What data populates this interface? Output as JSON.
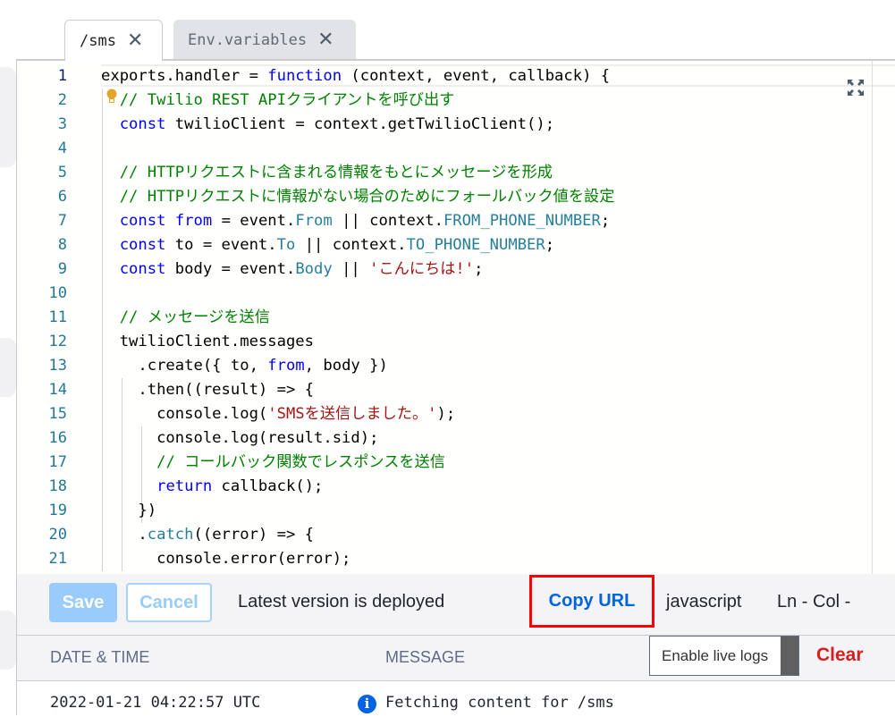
{
  "tabs": [
    {
      "label": "/sms",
      "active": true
    },
    {
      "label": "Env.variables",
      "active": false
    }
  ],
  "editor": {
    "active_line": 1,
    "lines": [
      [
        [
          "exports.handler = ",
          ""
        ],
        [
          "function",
          "kw"
        ],
        [
          " (context, event, callback) {",
          ""
        ]
      ],
      [
        [
          "  ",
          ""
        ],
        [
          "// Twilio REST APIクライアントを呼び出す",
          "cm"
        ]
      ],
      [
        [
          "  ",
          ""
        ],
        [
          "const",
          "kw"
        ],
        [
          " twilioClient = context.getTwilioClient();",
          ""
        ]
      ],
      [],
      [
        [
          "  ",
          ""
        ],
        [
          "// HTTPリクエストに含まれる情報をもとにメッセージを形成",
          "cm"
        ]
      ],
      [
        [
          "  ",
          ""
        ],
        [
          "// HTTPリクエストに情報がない場合のためにフォールバック値を設定",
          "cm"
        ]
      ],
      [
        [
          "  ",
          ""
        ],
        [
          "const",
          "kw"
        ],
        [
          " ",
          ""
        ],
        [
          "from",
          "kw"
        ],
        [
          " = event.",
          ""
        ],
        [
          "From",
          "pr"
        ],
        [
          " || context.",
          ""
        ],
        [
          "FROM_PHONE_NUMBER",
          "pr"
        ],
        [
          ";",
          ""
        ]
      ],
      [
        [
          "  ",
          ""
        ],
        [
          "const",
          "kw"
        ],
        [
          " to = event.",
          ""
        ],
        [
          "To",
          "pr"
        ],
        [
          " || context.",
          ""
        ],
        [
          "TO_PHONE_NUMBER",
          "pr"
        ],
        [
          ";",
          ""
        ]
      ],
      [
        [
          "  ",
          ""
        ],
        [
          "const",
          "kw"
        ],
        [
          " body = event.",
          ""
        ],
        [
          "Body",
          "pr"
        ],
        [
          " || ",
          ""
        ],
        [
          "'こんにちは!'",
          "st"
        ],
        [
          ";",
          ""
        ]
      ],
      [],
      [
        [
          "  ",
          ""
        ],
        [
          "// メッセージを送信",
          "cm"
        ]
      ],
      [
        [
          "  twilioClient.messages",
          ""
        ]
      ],
      [
        [
          "    .create({ to, ",
          ""
        ],
        [
          "from",
          "kw"
        ],
        [
          ", body })",
          ""
        ]
      ],
      [
        [
          "    .then((result) => {",
          ""
        ]
      ],
      [
        [
          "      console.log(",
          ""
        ],
        [
          "'SMSを送信しました。'",
          "st"
        ],
        [
          ");",
          ""
        ]
      ],
      [
        [
          "      console.log(result.sid);",
          ""
        ]
      ],
      [
        [
          "      ",
          ""
        ],
        [
          "// コールバック関数でレスポンスを送信",
          "cm"
        ]
      ],
      [
        [
          "      ",
          ""
        ],
        [
          "return",
          "kw"
        ],
        [
          " callback();",
          ""
        ]
      ],
      [
        [
          "    })",
          ""
        ]
      ],
      [
        [
          "    .",
          ""
        ],
        [
          "catch",
          "pr"
        ],
        [
          "((error) => {",
          ""
        ]
      ],
      [
        [
          "      console.error(error);",
          ""
        ]
      ]
    ]
  },
  "toolbar": {
    "save_label": "Save",
    "cancel_label": "Cancel",
    "status": "Latest version is deployed",
    "copy_url_label": "Copy URL",
    "language": "javascript",
    "cursor": "Ln -  Col -"
  },
  "logs": {
    "col_date": "DATE & TIME",
    "col_message": "MESSAGE",
    "live_logs_label": "Enable live logs",
    "live_logs_enabled": false,
    "clear_label": "Clear",
    "entries": [
      {
        "date": "2022-01-21 04:22:57 UTC",
        "level": "info",
        "message": "Fetching content for /sms"
      }
    ]
  },
  "colors": {
    "keyword": "#0000ff",
    "comment": "#008000",
    "property": "#267f99",
    "string": "#a31515",
    "accent": "#0263e0",
    "danger": "#d61f1f",
    "highlight": "#ff0000"
  }
}
